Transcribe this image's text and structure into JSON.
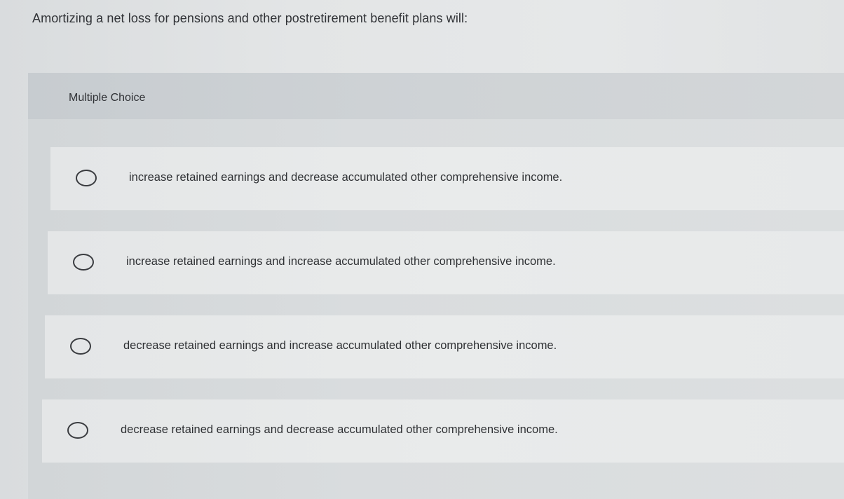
{
  "question": {
    "text": "Amortizing a net loss for pensions and other postretirement benefit plans will:"
  },
  "panel": {
    "header_label": "Multiple Choice"
  },
  "choices": [
    {
      "label": "increase retained earnings and decrease accumulated other comprehensive income.",
      "selected": false
    },
    {
      "label": "increase retained earnings and increase accumulated other comprehensive income.",
      "selected": false
    },
    {
      "label": "decrease retained earnings and increase accumulated other comprehensive income.",
      "selected": false
    },
    {
      "label": "decrease retained earnings and decrease accumulated other comprehensive income.",
      "selected": false
    }
  ]
}
